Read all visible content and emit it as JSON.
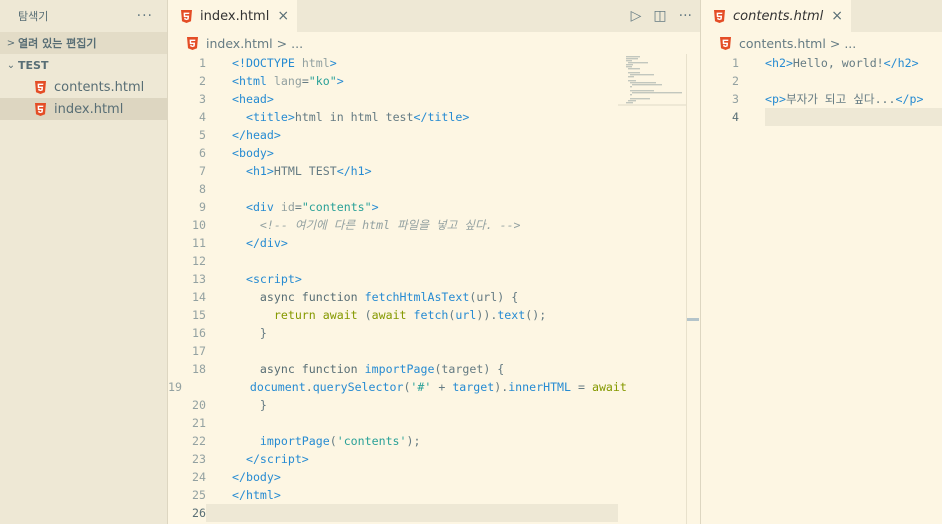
{
  "sidebar": {
    "title": "탐색기",
    "more": "···",
    "open_editors": "열려 있는 편집기",
    "folder": "TEST",
    "files": [
      {
        "name": "contents.html"
      },
      {
        "name": "index.html"
      }
    ]
  },
  "editor1": {
    "tab": "index.html",
    "close": "×",
    "actions": {
      "run": "▷",
      "split": "◫",
      "more": "···"
    },
    "breadcrumb": {
      "file": "index.html",
      "sep": ">",
      "rest": "..."
    }
  },
  "editor2": {
    "tab": "contents.html",
    "close": "×",
    "breadcrumb": {
      "file": "contents.html",
      "sep": ">",
      "rest": "..."
    }
  },
  "colors": {
    "background": "#fdf6e3",
    "sidebar": "#eee8d5",
    "html5_icon": "#e44d26",
    "tag": "#268bd2",
    "string": "#2aa198",
    "keyword": "#859900"
  }
}
